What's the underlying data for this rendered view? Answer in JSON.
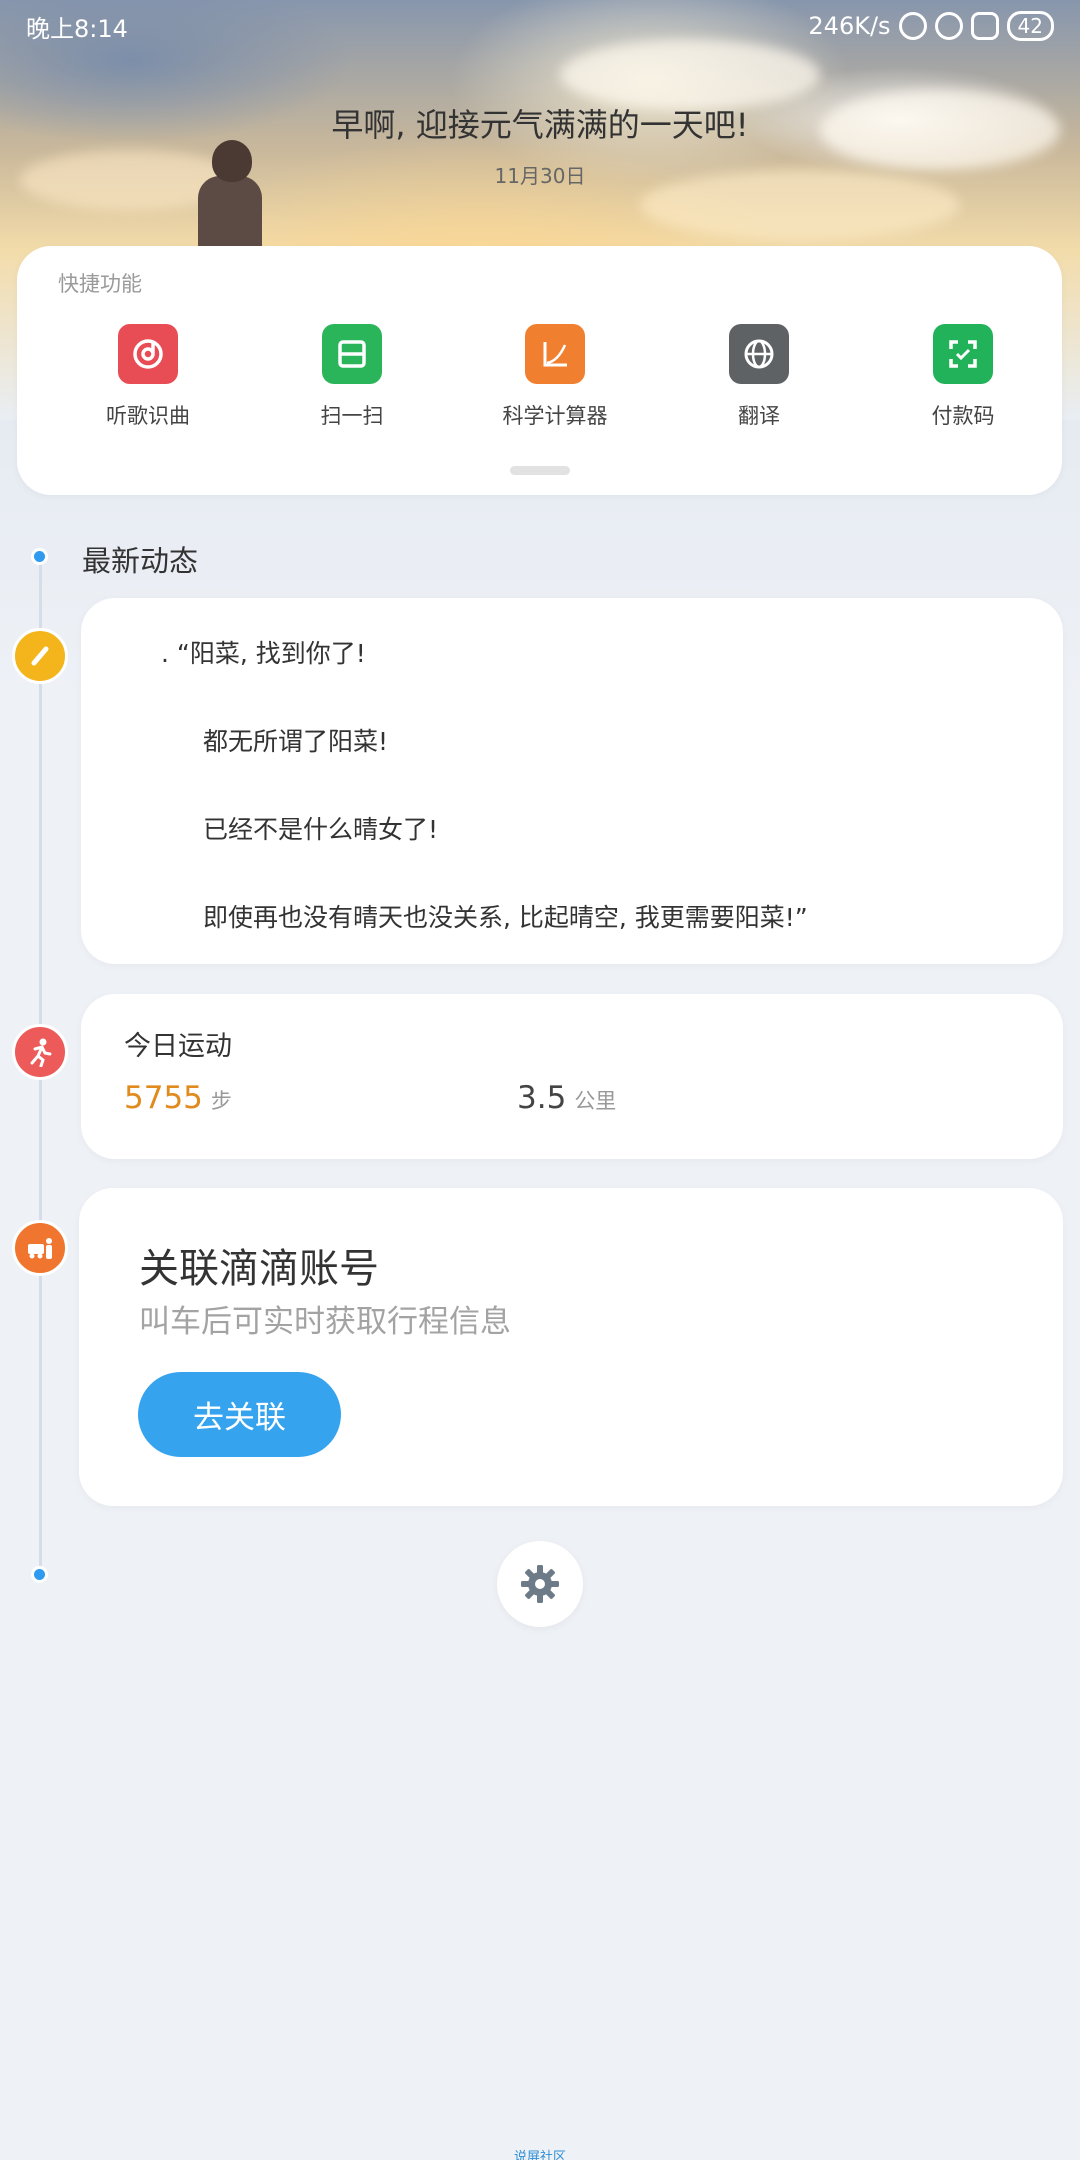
{
  "status_bar": {
    "time": "晚上8:14",
    "net_speed": "246K/s",
    "battery": "42"
  },
  "header": {
    "greeting": "早啊, 迎接元气满满的一天吧!",
    "date": "11月30日"
  },
  "quick_functions": {
    "title": "快捷功能",
    "items": [
      {
        "label": "听歌识曲",
        "icon": "music-recognition-icon",
        "color": "#e84c55"
      },
      {
        "label": "扫一扫",
        "icon": "scan-icon",
        "color": "#2bb55a"
      },
      {
        "label": "科学计算器",
        "icon": "calculator-icon",
        "color": "#f0802f"
      },
      {
        "label": "翻译",
        "icon": "globe-icon",
        "color": "#5f6264"
      },
      {
        "label": "付款码",
        "icon": "pay-code-icon",
        "color": "#22b25a"
      }
    ]
  },
  "feed": {
    "title": "最新动态",
    "note": {
      "lines": [
        ". “阳菜, 找到你了!",
        "都无所谓了阳菜!",
        "已经不是什么晴女了!",
        "即使再也没有晴天也没关系, 比起晴空, 我更需要阳菜!”"
      ],
      "icon_color": "#f3b51b"
    },
    "sport": {
      "title": "今日运动",
      "steps": "5755",
      "steps_unit": "步",
      "distance": "3.5",
      "distance_unit": "公里",
      "icon_color": "#ec5a5a"
    },
    "didi": {
      "title": "关联滴滴账号",
      "subtitle": "叫车后可实时获取行程信息",
      "button": "去关联",
      "icon_color": "#f0762f"
    }
  },
  "footer": {
    "text": "说屏社区"
  },
  "colors": {
    "accent": "#36a3ef",
    "steps": "#e18a1e"
  }
}
